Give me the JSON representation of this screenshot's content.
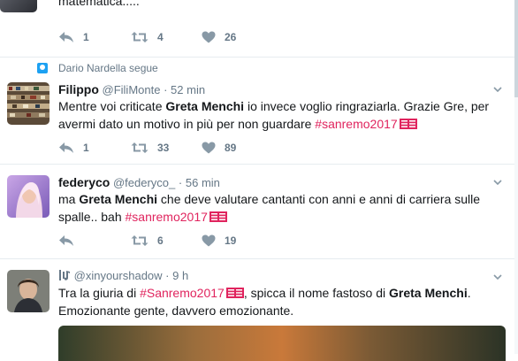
{
  "tweets": [
    {
      "text": "matematica.....",
      "replies": "1",
      "retweets": "4",
      "likes": "26"
    },
    {
      "context": "Dario Nardella segue",
      "name": "Filippo",
      "handle": "@FiliMonte",
      "dot": "·",
      "time": "52 min",
      "pre": "Mentre voi criticate ",
      "bold": "Greta Menchi",
      "mid": " io invece voglio ringraziarla. Grazie Gre, per avermi dato un motivo in più per non guardare ",
      "hashtag": "#sanremo2017",
      "replies": "1",
      "retweets": "33",
      "likes": "89"
    },
    {
      "name": "federyco",
      "handle": "@federyco_",
      "dot": "·",
      "time": "56 min",
      "pre": "ma ",
      "bold": "Greta Menchi",
      "mid": " che deve valutare cantanti con anni e anni di carriera sulle spalle.. bah ",
      "hashtag": "#sanremo2017",
      "replies": "",
      "retweets": "6",
      "likes": "19"
    },
    {
      "handle": "@xinyourshadow",
      "dot": "·",
      "time": "9 h",
      "pre": "Tra la giuria di ",
      "hashtag": "#Sanremo2017",
      "mid": ", spicca il nome fastoso di ",
      "bold": "Greta Menchi",
      "post": ". Emozionante gente, davvero emozionante."
    }
  ],
  "icons": {
    "reply": "reply-icon",
    "retweet": "retweet-icon",
    "like": "heart-icon",
    "menu": "chevron-down-icon",
    "flag": "sanremo-flag-icon"
  },
  "colors": {
    "hashtag": "#e0245e",
    "meta": "#657786",
    "border": "#e6ecf0"
  }
}
